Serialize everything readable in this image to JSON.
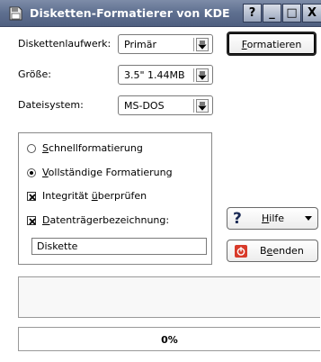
{
  "window": {
    "title": "Disketten-Formatierer von KDE",
    "titlebar_buttons": [
      "?",
      "_",
      "□",
      "X"
    ]
  },
  "form": {
    "drive_label": "Diskettenlaufwerk:",
    "drive_value": "Primär",
    "size_label": "Größe:",
    "size_value": "3.5\" 1.44MB",
    "fs_label": "Dateisystem:",
    "fs_value": "MS-DOS"
  },
  "buttons": {
    "format_mnemonic": "F",
    "format_rest": "ormatieren",
    "help_mnemonic": "H",
    "help_rest": "ilfe",
    "quit_pre": "B",
    "quit_mnemonic": "e",
    "quit_rest": "enden"
  },
  "options": {
    "quick_mnemonic": "S",
    "quick_rest": "chnellformatierung",
    "quick_selected": false,
    "full_mnemonic": "V",
    "full_rest": "ollständige Formatierung",
    "full_selected": true,
    "verify_pre": "Integrität ",
    "verify_mnemonic": "ü",
    "verify_rest": "berprüfen",
    "verify_checked": true,
    "label_mnemonic": "D",
    "label_rest": "atenträgerbezeichnung:",
    "label_checked": true,
    "label_value": "Diskette"
  },
  "progress": {
    "percent_text": "0%",
    "value": 0
  },
  "colors": {
    "titlebar": "#5e6f8f",
    "progress_fill": "#6a7ca0",
    "quit_icon": "#d83a2a"
  }
}
